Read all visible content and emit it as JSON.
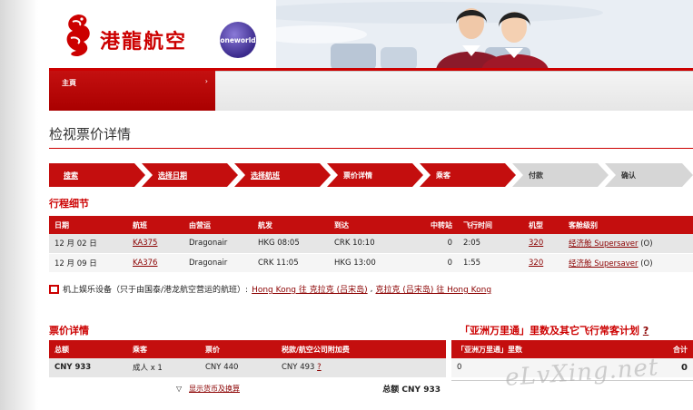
{
  "brand": {
    "name": "港龍航空",
    "alliance": "oneworld"
  },
  "nav": {
    "home": "主頁",
    "home_arrow": "›"
  },
  "page_title": "检视票价详情",
  "steps": [
    {
      "label": "搜索",
      "state": "done"
    },
    {
      "label": "选择日期",
      "state": "done"
    },
    {
      "label": "选择航班",
      "state": "done"
    },
    {
      "label": "票价详情",
      "state": "current"
    },
    {
      "label": "乘客",
      "state": "todo"
    },
    {
      "label": "付款",
      "state": "todo"
    },
    {
      "label": "确认",
      "state": "todo"
    }
  ],
  "itinerary": {
    "heading": "行程细节",
    "columns": [
      "日期",
      "航班",
      "由营运",
      "航发",
      "到达",
      "中转站",
      "飞行时间",
      "机型",
      "客舱级别"
    ],
    "rows": [
      {
        "date": "12 月 02 日",
        "flight": "KA375",
        "operator": "Dragonair",
        "depart": "HKG 08:05",
        "arrive": "CRK 10:10",
        "stops": "0",
        "duration": "2:05",
        "aircraft": "320",
        "cabin_link": "经济舱 Supersaver",
        "cabin_code": "(O)"
      },
      {
        "date": "12 月 09 日",
        "flight": "KA376",
        "operator": "Dragonair",
        "depart": "CRK 11:05",
        "arrive": "HKG 13:00",
        "stops": "0",
        "duration": "1:55",
        "aircraft": "320",
        "cabin_link": "经济舱 Supersaver",
        "cabin_code": "(O)"
      }
    ]
  },
  "entertainment": {
    "label": "机上娱乐设备（只于由国泰/港龙航空营运的航班）:",
    "link1": "Hong Kong 往 克拉克 (吕宋岛)",
    "sep": ",",
    "link2": "克拉克 (吕宋岛) 往 Hong Kong"
  },
  "fare": {
    "heading": "票价详情",
    "columns": [
      "总额",
      "乘客",
      "票价",
      "税款/航空公司附加费"
    ],
    "row": {
      "total": "CNY 933",
      "pax": "成人 x 1",
      "fare": "CNY 440",
      "tax": "CNY 493",
      "tax_help": "?"
    },
    "toggle_link": "显示货币及换算",
    "total_label": "总额 CNY 933"
  },
  "miles": {
    "heading": "「亚洲万里通」里数及其它飞行常客计划",
    "help": "?",
    "columns": [
      "「亚洲万里通」里数",
      "合计"
    ],
    "row": {
      "miles": "0",
      "total": "0"
    }
  },
  "watermark": "eLvXing.net",
  "colors": {
    "brand_red": "#c40e0e",
    "link": "#8b0000",
    "step_gray": "#d6d6d6"
  }
}
